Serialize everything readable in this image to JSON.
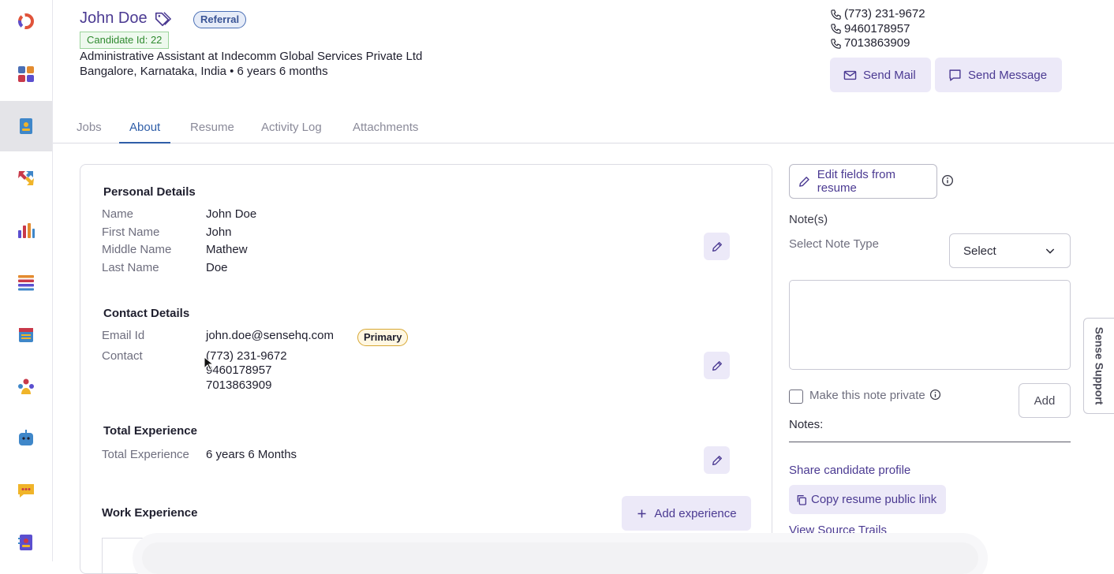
{
  "sidebar": {
    "items": [
      {
        "icon": "sense-logo-icon",
        "color": "#e0533a"
      },
      {
        "icon": "dashboard-icon",
        "color": "#4a6fb5"
      },
      {
        "icon": "candidate-profile-icon",
        "color": "#3f87c9"
      },
      {
        "icon": "workflow-arrows-icon",
        "color": "#c8394a"
      },
      {
        "icon": "analytics-bars-icon",
        "color": "#5b4fcf"
      },
      {
        "icon": "list-icon",
        "color": "#e38b2f"
      },
      {
        "icon": "calendar-icon",
        "color": "#3f87c9"
      },
      {
        "icon": "people-icon",
        "color": "#c8394a"
      },
      {
        "icon": "chatbot-icon",
        "color": "#3f87c9"
      },
      {
        "icon": "chat-bubble-icon",
        "color": "#f0b429"
      },
      {
        "icon": "contacts-book-icon",
        "color": "#5b4fcf"
      }
    ]
  },
  "header": {
    "name": "John Doe",
    "source_badge": "Referral",
    "candidate_id": "Candidate Id: 22",
    "role": "Administrative Assistant at Indecomm Global Services Private Ltd",
    "location": "Bangalore, Karnataka, India • 6 years 6 months",
    "phones": [
      "(773) 231-9672",
      "9460178957",
      "7013863909"
    ],
    "send_mail": "Send Mail",
    "send_message": "Send Message"
  },
  "tabs": [
    {
      "label": "Jobs"
    },
    {
      "label": "About"
    },
    {
      "label": "Resume"
    },
    {
      "label": "Activity Log"
    },
    {
      "label": "Attachments"
    }
  ],
  "active_tab": "About",
  "personal": {
    "title": "Personal Details",
    "rows": [
      {
        "label": "Name",
        "value": "John Doe"
      },
      {
        "label": "First Name",
        "value": "John"
      },
      {
        "label": "Middle Name",
        "value": "Mathew"
      },
      {
        "label": "Last Name",
        "value": "Doe"
      }
    ]
  },
  "contact": {
    "title": "Contact Details",
    "email_label": "Email Id",
    "email": "john.doe@sensehq.com",
    "primary_badge": "Primary",
    "contact_label": "Contact",
    "numbers": [
      "(773) 231-9672",
      "9460178957",
      "7013863909"
    ]
  },
  "experience": {
    "title": "Total Experience",
    "label": "Total Experience",
    "value": "6 years 6 Months"
  },
  "work": {
    "title": "Work Experience",
    "add_label": "Add experience"
  },
  "notes_panel": {
    "edit_fields_label": "Edit fields from resume",
    "notes_title": "Note(s)",
    "note_type_label": "Select Note Type",
    "select_value": "Select",
    "private_label": "Make this note private",
    "add_label": "Add",
    "notes_label": "Notes:",
    "share_label": "Share candidate profile",
    "copy_label": "Copy resume public link",
    "view_trails_label": "View Source Trails"
  },
  "support_label": "Sense Support",
  "colors": {
    "brand_purple": "#4b3a92",
    "tab_active": "#2f5ea8",
    "button_bg": "#ece9f8"
  }
}
